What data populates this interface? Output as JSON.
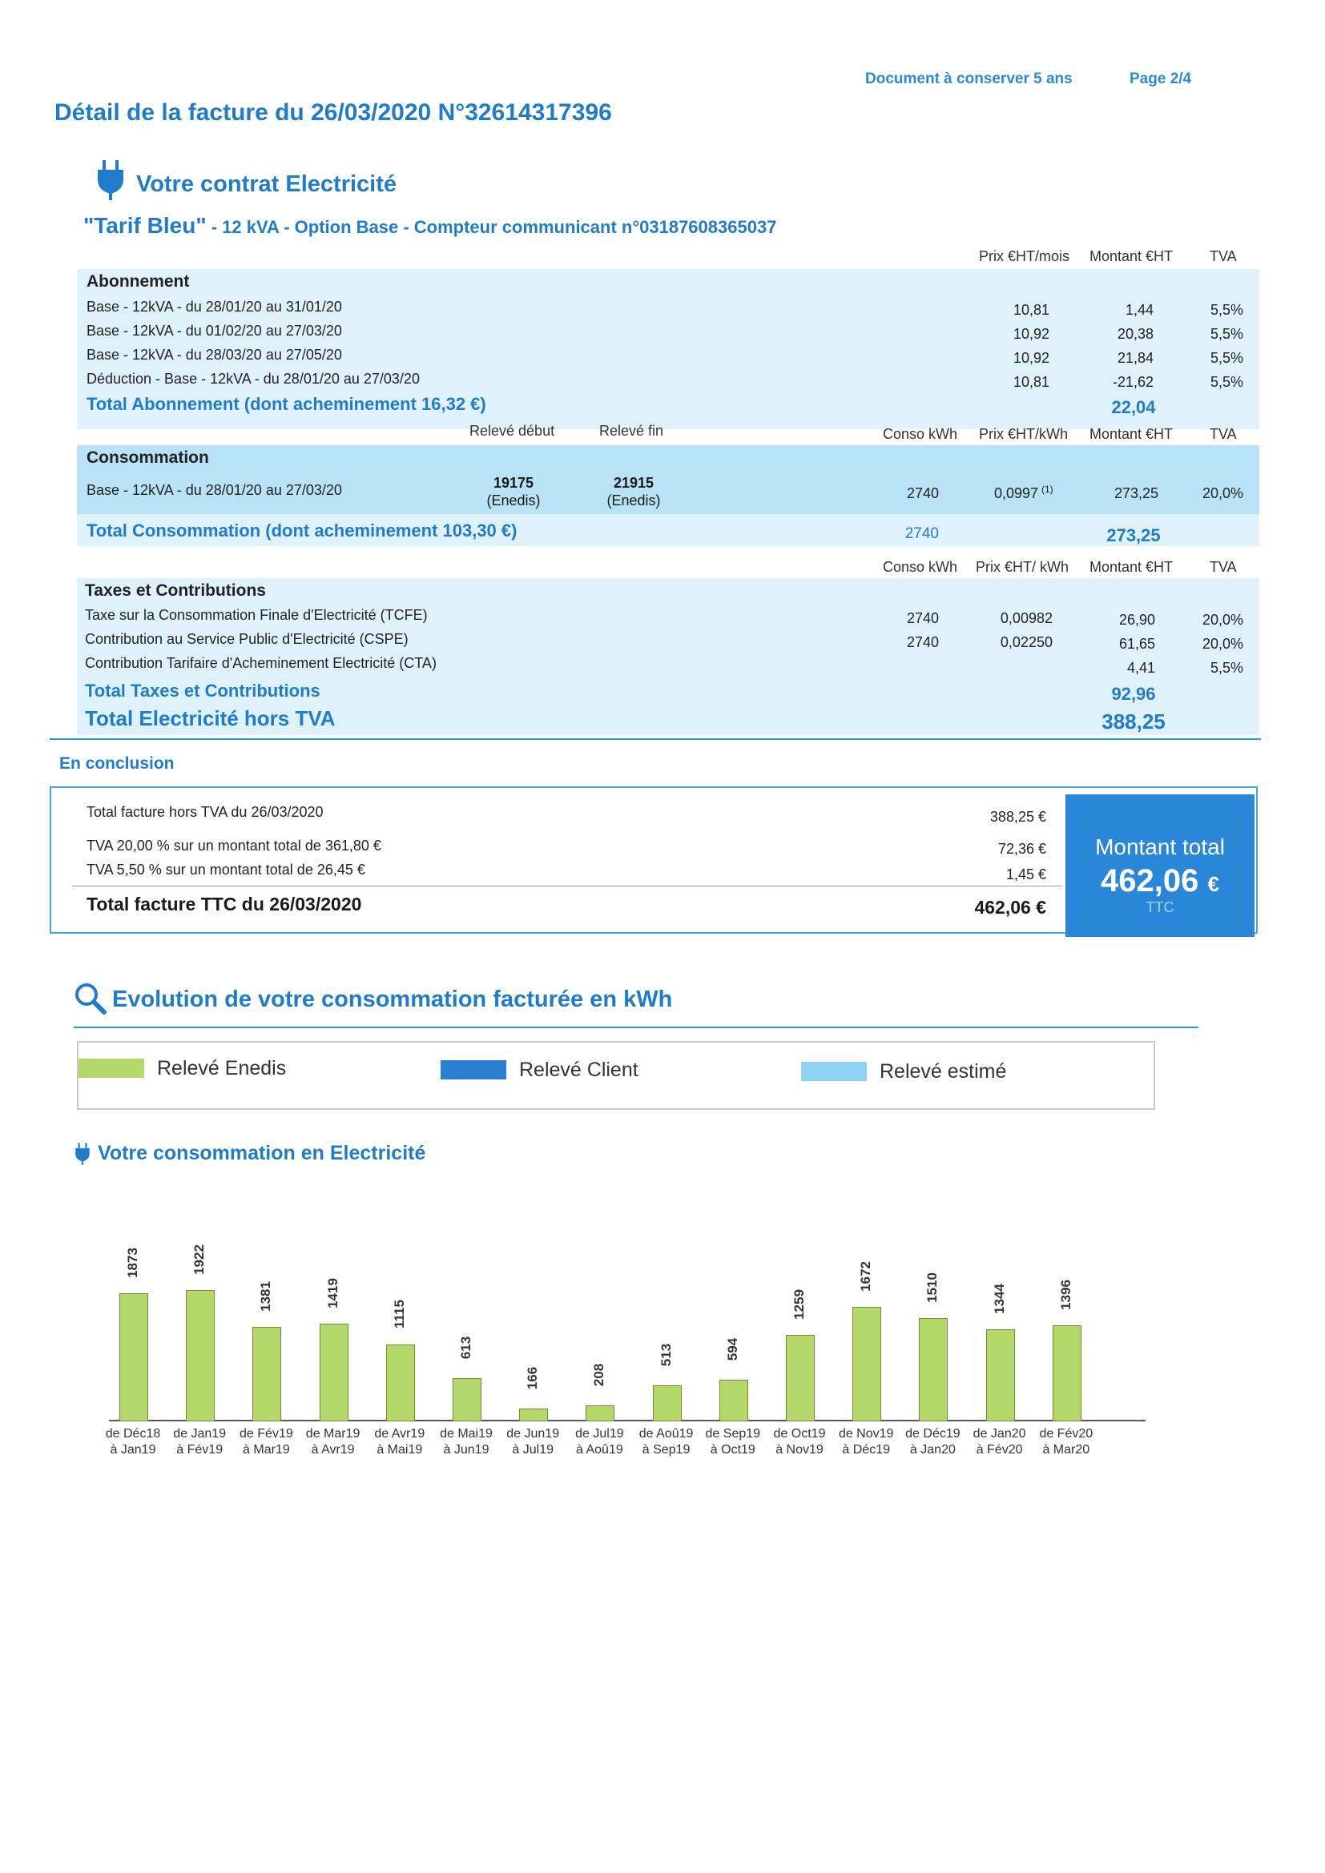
{
  "header": {
    "keep_notice": "Document à conserver 5 ans",
    "page": "Page 2/4",
    "title": "Détail de la facture du 26/03/2020 N°32614317396"
  },
  "contract": {
    "title": "Votre contrat Electricité",
    "tarif_name": "\"Tarif Bleu\"",
    "tarif_detail": " - 12 kVA - Option Base - Compteur communicant n°03187608365037"
  },
  "abonnement": {
    "col_prix": "Prix €HT/mois",
    "col_montant": "Montant €HT",
    "col_tva": "TVA",
    "section": "Abonnement",
    "rows": [
      {
        "label": "Base - 12kVA - du 28/01/20 au 31/01/20",
        "prix": "10,81",
        "montant": "1,44",
        "tva": "5,5%"
      },
      {
        "label": "Base - 12kVA - du 01/02/20 au 27/03/20",
        "prix": "10,92",
        "montant": "20,38",
        "tva": "5,5%"
      },
      {
        "label": "Base - 12kVA - du 28/03/20 au 27/05/20",
        "prix": "10,92",
        "montant": "21,84",
        "tva": "5,5%"
      },
      {
        "label": "Déduction - Base - 12kVA - du 28/01/20 au 27/03/20",
        "prix": "10,81",
        "montant": "-21,62",
        "tva": "5,5%"
      }
    ],
    "total_label": "Total Abonnement (dont acheminement 16,32 €)",
    "total_value": "22,04"
  },
  "consommation": {
    "col_debut": "Relevé début",
    "col_fin": "Relevé fin",
    "col_conso": "Conso kWh",
    "col_prix": "Prix €HT/kWh",
    "col_montant": "Montant €HT",
    "col_tva": "TVA",
    "section": "Consommation",
    "row": {
      "label": "Base - 12kVA - du 28/01/20 au 27/03/20",
      "debut": "19175",
      "debut_src": "(Enedis)",
      "fin": "21915",
      "fin_src": "(Enedis)",
      "conso": "2740",
      "prix": "0,0997",
      "prix_note": "(1)",
      "montant": "273,25",
      "tva": "20,0%"
    },
    "total_label": "Total Consommation (dont acheminement 103,30 €)",
    "total_conso": "2740",
    "total_value": "273,25"
  },
  "taxes": {
    "col_conso": "Conso kWh",
    "col_prix": "Prix €HT/ kWh",
    "col_montant": "Montant €HT",
    "col_tva": "TVA",
    "section": "Taxes et Contributions",
    "rows": [
      {
        "label": "Taxe sur la Consommation Finale d'Electricité (TCFE)",
        "conso": "2740",
        "prix": "0,00982",
        "montant": "26,90",
        "tva": "20,0%"
      },
      {
        "label": "Contribution au Service Public d'Electricité (CSPE)",
        "conso": "2740",
        "prix": "0,02250",
        "montant": "61,65",
        "tva": "20,0%"
      },
      {
        "label": "Contribution Tarifaire d'Acheminement Electricité (CTA)",
        "conso": "",
        "prix": "",
        "montant": "4,41",
        "tva": "5,5%"
      }
    ],
    "total_label": "Total Taxes et Contributions",
    "total_value": "92,96",
    "grand_label": "Total Electricité hors TVA",
    "grand_value": "388,25"
  },
  "conclusion": {
    "title": "En conclusion",
    "rows": [
      {
        "label": "Total facture hors TVA du 26/03/2020",
        "value": "388,25 €"
      },
      {
        "label": "TVA 20,00 % sur un montant total de 361,80 €",
        "value": "72,36 €"
      },
      {
        "label": "TVA 5,50 % sur un montant total de 26,45 €",
        "value": "1,45 €"
      }
    ],
    "total_label": "Total facture TTC du 26/03/2020",
    "total_value": "462,06 €",
    "box_title": "Montant total",
    "box_amount": "462,06",
    "box_currency": "€",
    "box_suffix": "TTC"
  },
  "evolution": {
    "title": "Evolution de votre consommation facturée en kWh",
    "legend": [
      {
        "label": "Relevé Enedis",
        "color": "#b4d96a"
      },
      {
        "label": "Relevé Client",
        "color": "#2a7fd0"
      },
      {
        "label": "Relevé estimé",
        "color": "#8fd3f4"
      }
    ],
    "subtitle": "Votre consommation en Electricité"
  },
  "chart_data": {
    "type": "bar",
    "categories": [
      [
        "de Déc18",
        "à Jan19"
      ],
      [
        "de Jan19",
        "à Fév19"
      ],
      [
        "de Fév19",
        "à Mar19"
      ],
      [
        "de Mar19",
        "à Avr19"
      ],
      [
        "de Avr19",
        "à Mai19"
      ],
      [
        "de Mai19",
        "à Jun19"
      ],
      [
        "de Jun19",
        "à Jul19"
      ],
      [
        "de Jul19",
        "à Aoû19"
      ],
      [
        "de Aoû19",
        "à Sep19"
      ],
      [
        "de Sep19",
        "à Oct19"
      ],
      [
        "de Oct19",
        "à Nov19"
      ],
      [
        "de Nov19",
        "à Déc19"
      ],
      [
        "de Déc19",
        "à Jan20"
      ],
      [
        "de Jan20",
        "à Fév20"
      ],
      [
        "de Fév20",
        "à Mar20"
      ]
    ],
    "values": [
      1873,
      1922,
      1381,
      1419,
      1115,
      613,
      166,
      208,
      513,
      594,
      1259,
      1672,
      1510,
      1344,
      1396
    ],
    "value_labels": [
      "1873",
      "1922",
      "1381",
      "1419",
      "1115",
      "613",
      "166",
      "208",
      "513",
      "594",
      "1259",
      "1672",
      "1510",
      "1344",
      "1396"
    ],
    "bar_color": "#b4d96a",
    "ylim": [
      0,
      2000
    ],
    "grid": false
  }
}
